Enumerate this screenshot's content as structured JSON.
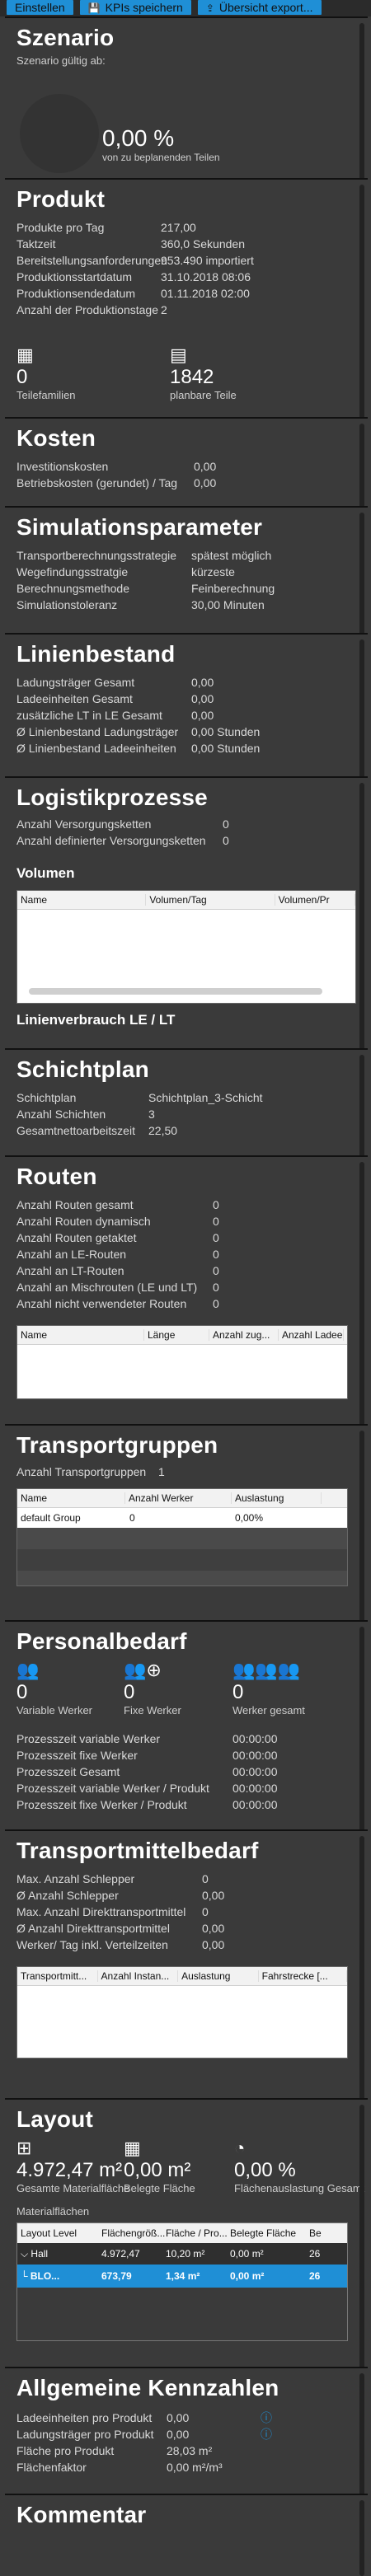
{
  "topbar": {
    "buttons": [
      {
        "label": "Einstellen"
      },
      {
        "label": "KPIs speichern"
      },
      {
        "label": "Übersicht export..."
      }
    ]
  },
  "szenario": {
    "title": "Szenario",
    "subtitle": "Szenario gültig ab:",
    "value": "0,00 %",
    "value_caption": "von zu beplanenden Teilen"
  },
  "produkt": {
    "title": "Produkt",
    "rows": [
      {
        "k": "Produkte pro Tag",
        "v": "217,00"
      },
      {
        "k": "Taktzeit",
        "v": "360,0 Sekunden"
      },
      {
        "k": "Bereitstellungsanforderungen",
        "v": "953.490 importiert"
      },
      {
        "k": "Produktionsstartdatum",
        "v": "31.10.2018 08:06"
      },
      {
        "k": "Produktionsendedatum",
        "v": "01.11.2018 02:00"
      },
      {
        "k": "Anzahl der Produktionstage",
        "v": "2"
      }
    ],
    "teilefamilien_value": "0",
    "teilefamilien_label": "Teilefamilien",
    "planbare_value": "1842",
    "planbare_label": "planbare Teile"
  },
  "kosten": {
    "title": "Kosten",
    "rows": [
      {
        "k": "Investitionskosten",
        "v": "0,00"
      },
      {
        "k": "Betriebskosten (gerundet) / Tag",
        "v": "0,00"
      }
    ]
  },
  "simulation": {
    "title": "Simulationsparameter",
    "rows": [
      {
        "k": "Transportberechnungsstrategie",
        "v": "spätest möglich"
      },
      {
        "k": "Wegefindungsstratgie",
        "v": "kürzeste"
      },
      {
        "k": "Berechnungsmethode",
        "v": "Feinberechnung"
      },
      {
        "k": "Simulationstoleranz",
        "v": "30,00 Minuten"
      }
    ]
  },
  "linienbestand": {
    "title": "Linienbestand",
    "rows": [
      {
        "k": "Ladungsträger Gesamt",
        "v": "0,00"
      },
      {
        "k": "Ladeeinheiten Gesamt",
        "v": "0,00"
      },
      {
        "k": "zusätzliche LT in LE Gesamt",
        "v": "0,00"
      },
      {
        "k": "Ø Linienbestand Ladungsträger",
        "v": "0,00 Stunden"
      },
      {
        "k": "Ø Linienbestand Ladeeinheiten",
        "v": "0,00 Stunden"
      }
    ]
  },
  "logistik": {
    "title": "Logistikprozesse",
    "rows": [
      {
        "k": "Anzahl Versorgungsketten",
        "v": "0"
      },
      {
        "k": "Anzahl definierter Versorgungsketten",
        "v": "0"
      }
    ],
    "volumen_title": "Volumen",
    "volumen_cols": [
      "Name",
      "Volumen/Tag",
      "Volumen/Pr"
    ],
    "linienverbrauch_title": "Linienverbrauch LE / LT"
  },
  "schichtplan": {
    "title": "Schichtplan",
    "rows": [
      {
        "k": "Schichtplan",
        "v": "Schichtplan_3-Schicht"
      },
      {
        "k": "Anzahl Schichten",
        "v": "3"
      },
      {
        "k": "Gesamtnettoarbeitszeit",
        "v": "22,50"
      }
    ]
  },
  "routen": {
    "title": "Routen",
    "rows": [
      {
        "k": "Anzahl Routen gesamt",
        "v": "0"
      },
      {
        "k": "Anzahl Routen dynamisch",
        "v": "0"
      },
      {
        "k": "Anzahl Routen getaktet",
        "v": "0"
      },
      {
        "k": "Anzahl an LE-Routen",
        "v": "0"
      },
      {
        "k": "Anzahl an LT-Routen",
        "v": "0"
      },
      {
        "k": "Anzahl an Mischrouten (LE und LT)",
        "v": "0"
      },
      {
        "k": "Anzahl nicht verwendeter Routen",
        "v": "0"
      }
    ],
    "cols": [
      "Name",
      "Länge",
      "Anzahl zug...",
      "Anzahl Ladee"
    ]
  },
  "transportgruppen": {
    "title": "Transportgruppen",
    "count_label": "Anzahl Transportgruppen",
    "count_value": "1",
    "cols": [
      "Name",
      "Anzahl Werker",
      "Auslastung"
    ],
    "rows": [
      {
        "name": "default Group",
        "werker": "0",
        "auslastung": "0,00%"
      }
    ]
  },
  "personal": {
    "title": "Personalbedarf",
    "stats": [
      {
        "value": "0",
        "label": "Variable Werker",
        "icon": "people-icon"
      },
      {
        "value": "0",
        "label": "Fixe Werker",
        "icon": "people-plus-icon"
      },
      {
        "value": "0",
        "label": "Werker gesamt",
        "icon": "group-icon"
      }
    ],
    "rows": [
      {
        "k": "Prozesszeit variable Werker",
        "v": "00:00:00"
      },
      {
        "k": "Prozesszeit fixe Werker",
        "v": "00:00:00"
      },
      {
        "k": "Prozesszeit Gesamt",
        "v": "00:00:00"
      },
      {
        "k": "Prozesszeit variable Werker / Produkt",
        "v": "00:00:00"
      },
      {
        "k": "Prozesszeit fixe Werker / Produkt",
        "v": "00:00:00"
      }
    ]
  },
  "transportmittel": {
    "title": "Transportmittelbedarf",
    "rows": [
      {
        "k": "Max. Anzahl Schlepper",
        "v": "0"
      },
      {
        "k": "Ø Anzahl Schlepper",
        "v": "0,00"
      },
      {
        "k": "Max. Anzahl Direkttransportmittel",
        "v": "0"
      },
      {
        "k": "Ø Anzahl Direkttransportmittel",
        "v": "0,00"
      },
      {
        "k": "Werker/ Tag inkl. Verteilzeiten",
        "v": "0,00"
      }
    ],
    "cols": [
      "Transportmitt...",
      "Anzahl Instan...",
      "Auslastung",
      "Fahrstrecke [..."
    ]
  },
  "layout": {
    "title": "Layout",
    "stats": [
      {
        "value": "4.972,47 m²",
        "label": "Gesamte Materialfläche"
      },
      {
        "value": "0,00 m²",
        "label": "Belegte Fläche"
      },
      {
        "value": "0,00 %",
        "label": "Flächenauslastung Gesamt"
      }
    ],
    "materialflaechen_label": "Materialflächen",
    "cols": [
      "Layout Level",
      "Flächengröß...",
      "Fläche / Pro...",
      "Belegte Fläche",
      "Be"
    ],
    "rows": [
      {
        "c": [
          "⌵ Hall",
          "4.972,47",
          "10,20 m²",
          "0,00 m²",
          "26"
        ],
        "selected": false
      },
      {
        "c": [
          "└ BLO...",
          "673,79",
          "1,34 m²",
          "0,00 m²",
          "26"
        ],
        "selected": true
      }
    ]
  },
  "kennzahlen": {
    "title": "Allgemeine Kennzahlen",
    "rows": [
      {
        "k": "Ladeeinheiten pro Produkt",
        "v": "0,00"
      },
      {
        "k": "Ladungsträger pro Produkt",
        "v": "0,00"
      },
      {
        "k": "Fläche pro Produkt",
        "v": "28,03 m²"
      },
      {
        "k": "Flächenfaktor",
        "v": "0,00 m²/m³"
      }
    ]
  },
  "kommentar": {
    "title": "Kommentar"
  }
}
